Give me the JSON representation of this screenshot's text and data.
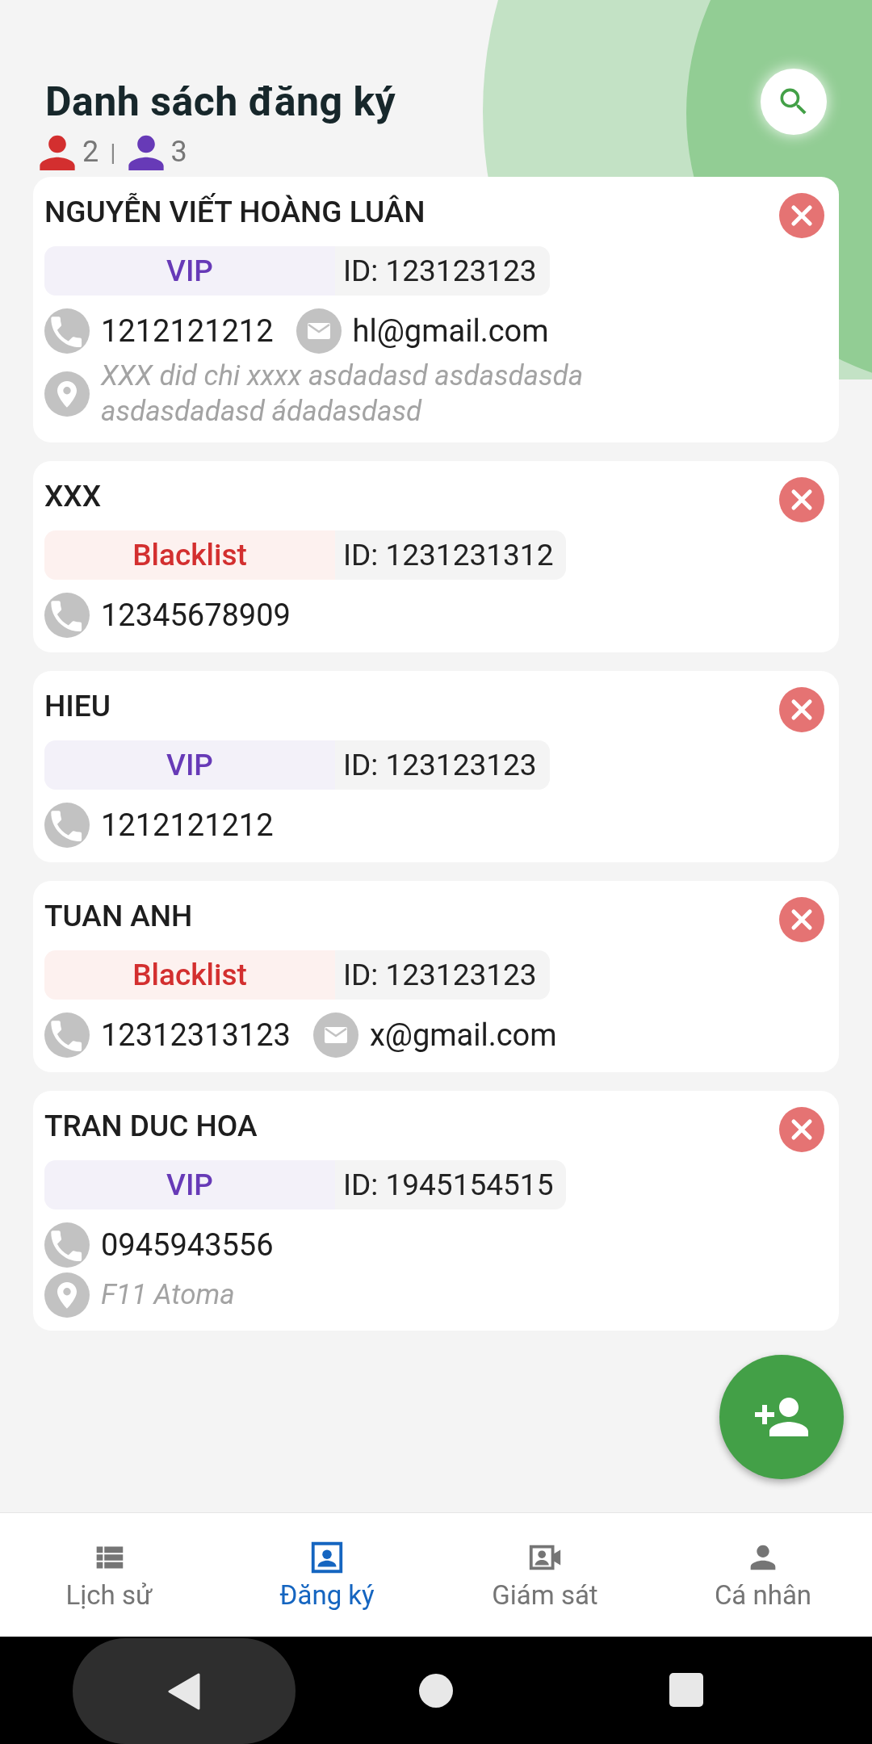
{
  "header": {
    "title": "Danh sách đăng ký"
  },
  "counts": [
    {
      "value": "2",
      "color": "#d32f2f"
    },
    {
      "value": "3",
      "color": "#673ab7"
    }
  ],
  "counts_separator": "|",
  "contacts": [
    {
      "name": "NGUYỄN VIẾT HOÀNG LUÂN",
      "tag": {
        "kind": "vip",
        "label": "VIP"
      },
      "id": "ID: 123123123",
      "phone": "1212121212",
      "email": "hl@gmail.com",
      "address": "XXX did chi xxxx asdadasd asdasdasda asdasdadasd ádadasdasd"
    },
    {
      "name": "XXX",
      "tag": {
        "kind": "blacklist",
        "label": "Blacklist"
      },
      "id": "ID: 1231231312",
      "phone": "12345678909"
    },
    {
      "name": "HIEU",
      "tag": {
        "kind": "vip",
        "label": "VIP"
      },
      "id": "ID: 123123123",
      "phone": "1212121212"
    },
    {
      "name": "TUAN ANH",
      "tag": {
        "kind": "blacklist",
        "label": "Blacklist"
      },
      "id": "ID: 123123123",
      "phone": "12312313123",
      "email": "x@gmail.com"
    },
    {
      "name": "TRAN DUC HOA",
      "tag": {
        "kind": "vip",
        "label": "VIP"
      },
      "id": "ID: 1945154515",
      "phone": "0945943556",
      "address": "F11 Atoma"
    }
  ],
  "bottom_nav": [
    {
      "kind": "history",
      "label": "Lịch sử",
      "selected": false
    },
    {
      "kind": "register",
      "label": "Đăng ký",
      "selected": true
    },
    {
      "kind": "monitor",
      "label": "Giám sát",
      "selected": false
    },
    {
      "kind": "profile",
      "label": "Cá nhân",
      "selected": false
    }
  ]
}
